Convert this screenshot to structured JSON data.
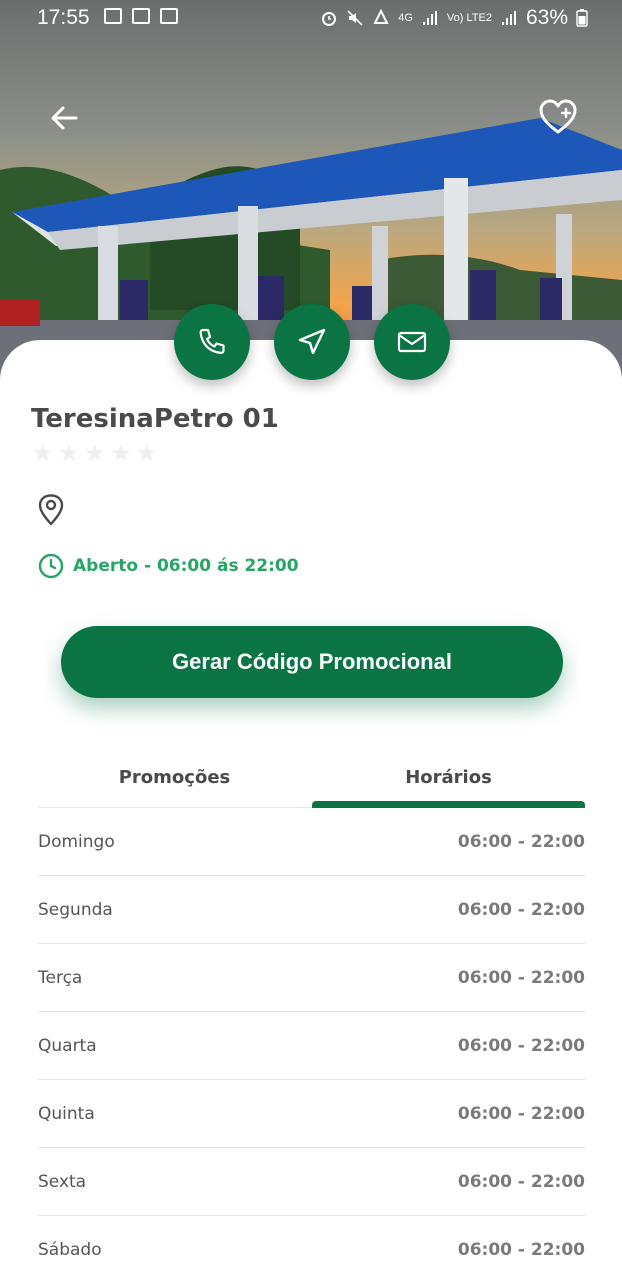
{
  "status_bar": {
    "time": "17:55",
    "battery": "63%",
    "net_4g": "4G",
    "net_volte": "Vo) LTE2"
  },
  "station": {
    "name": "TeresinaPetro 01",
    "rating": 0,
    "stars_max": 5,
    "status_hours": "Aberto - 06:00 ás 22:00"
  },
  "icons": {
    "back": "arrow-left-icon",
    "favorite": "heart-plus-icon",
    "call": "phone-icon",
    "navigate": "navigation-icon",
    "email": "mail-icon",
    "location": "map-pin-icon",
    "clock": "clock-icon"
  },
  "actions": {
    "promo_button": "Gerar Código Promocional"
  },
  "tabs": [
    {
      "label": "Promoções",
      "active": false
    },
    {
      "label": "Horários",
      "active": true
    }
  ],
  "schedule": [
    {
      "day": "Domingo",
      "hours": "06:00 - 22:00"
    },
    {
      "day": "Segunda",
      "hours": "06:00 - 22:00"
    },
    {
      "day": "Terça",
      "hours": "06:00 - 22:00"
    },
    {
      "day": "Quarta",
      "hours": "06:00 - 22:00"
    },
    {
      "day": "Quinta",
      "hours": "06:00 - 22:00"
    },
    {
      "day": "Sexta",
      "hours": "06:00 - 22:00"
    },
    {
      "day": "Sábado",
      "hours": "06:00 - 22:00"
    }
  ],
  "colors": {
    "primary": "#0a7444",
    "open_green": "#27a565",
    "text": "#4a4a4a"
  }
}
